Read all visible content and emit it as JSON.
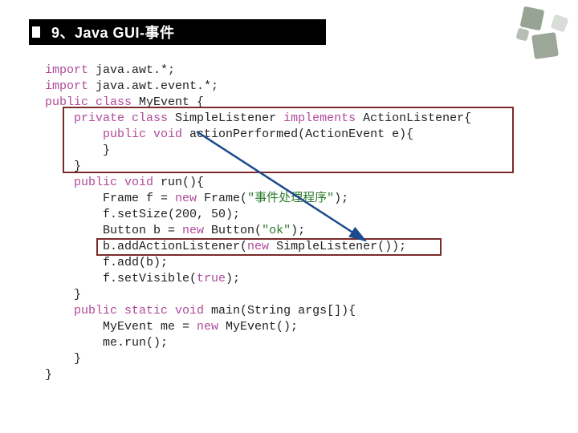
{
  "title": "9、Java GUI-事件",
  "code": {
    "l01a": "import",
    "l01b": " java.awt.*;",
    "l02a": "import",
    "l02b": " java.awt.event.*;",
    "l03a": "public class",
    "l03b": " MyEvent {",
    "l04a": "private class",
    "l04b": " SimpleListener ",
    "l04c": "implements",
    "l04d": " ActionListener{",
    "l05a": "public void",
    "l05b": " actionPerformed(ActionEvent e){",
    "l06": "        }",
    "l07": "    }",
    "l08a": "public void",
    "l08b": " run(){",
    "l09a": "        Frame f = ",
    "l09b": "new",
    "l09c": " Frame(",
    "l09d": "\"事件处理程序\"",
    "l09e": ");",
    "l10": "        f.setSize(200, 50);",
    "l11a": "        Button b = ",
    "l11b": "new",
    "l11c": " Button(",
    "l11d": "\"ok\"",
    "l11e": ");",
    "l12a": "        b.addActionListener(",
    "l12b": "new",
    "l12c": " SimpleListener());",
    "l13": "        f.add(b);",
    "l14a": "        f.setVisible(",
    "l14b": "true",
    "l14c": ");",
    "l15": "    }",
    "l16a": "public static void",
    "l16b": " main(String args[]){",
    "l17a": "        MyEvent me = ",
    "l17b": "new",
    "l17c": " MyEvent();",
    "l18": "        me.run();",
    "l19": "    }",
    "l20": "}"
  }
}
